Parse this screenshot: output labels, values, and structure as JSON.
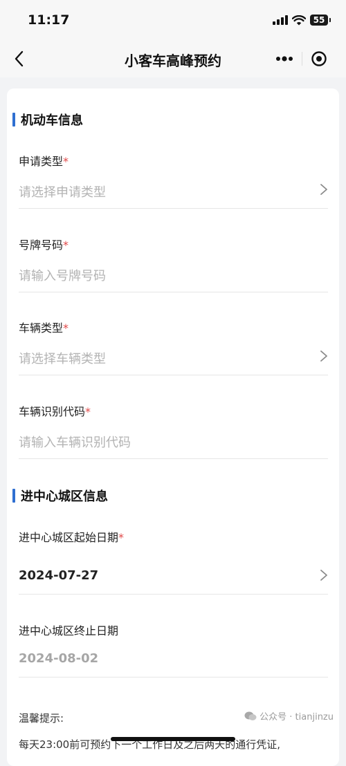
{
  "status_bar": {
    "time": "11:17",
    "battery": "55"
  },
  "nav": {
    "title": "小客车高峰预约"
  },
  "sections": [
    {
      "title": "机动车信息"
    },
    {
      "title": "进中心城区信息"
    }
  ],
  "fields": {
    "apply_type": {
      "label": "申请类型",
      "required_mark": "*",
      "placeholder": "请选择申请类型"
    },
    "plate_number": {
      "label": "号牌号码",
      "required_mark": "*",
      "placeholder": "请输入号牌号码"
    },
    "vehicle_type": {
      "label": "车辆类型",
      "required_mark": "*",
      "placeholder": "请选择车辆类型"
    },
    "vin": {
      "label": "车辆识别代码",
      "required_mark": "*",
      "placeholder": "请输入车辆识别代码"
    },
    "start_date": {
      "label": "进中心城区起始日期",
      "required_mark": "*",
      "value": "2024-07-27"
    },
    "end_date": {
      "label": "进中心城区终止日期",
      "value": "2024-08-02"
    }
  },
  "tip": {
    "label": "温馨提示:",
    "text": "每天23:00前可预约下一个工作日及之后两天的通行凭证,"
  },
  "watermark": {
    "text": "公众号 · tianjinzu"
  }
}
